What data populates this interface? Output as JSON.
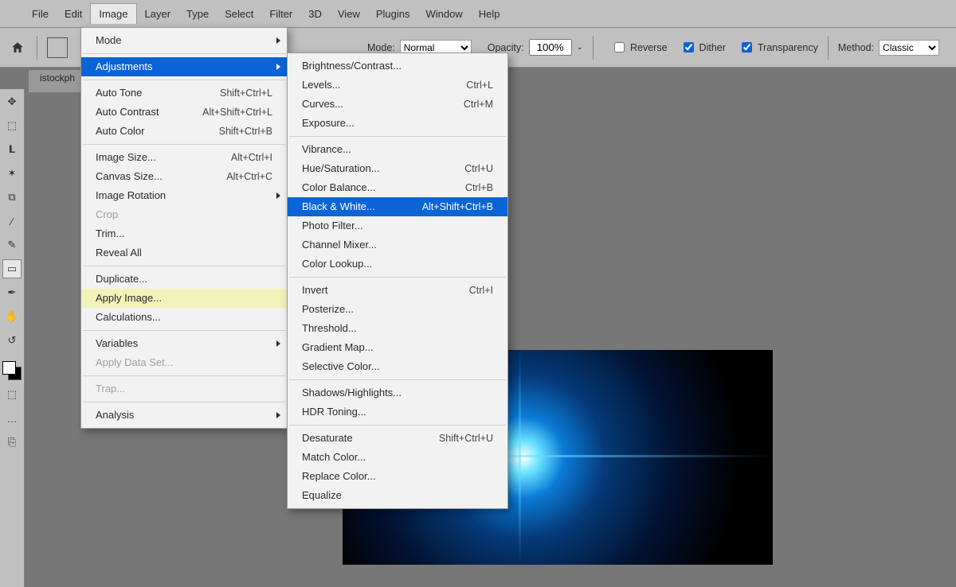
{
  "menubar": {
    "items": [
      "File",
      "Edit",
      "Image",
      "Layer",
      "Type",
      "Select",
      "Filter",
      "3D",
      "View",
      "Plugins",
      "Window",
      "Help"
    ],
    "open_index": 2
  },
  "optionsbar": {
    "mode_label": "Mode:",
    "mode_value": "Normal",
    "opacity_label": "Opacity:",
    "opacity_value": "100%",
    "reverse_label": "Reverse",
    "reverse_checked": false,
    "dither_label": "Dither",
    "dither_checked": true,
    "transparency_label": "Transparency",
    "transparency_checked": true,
    "method_label": "Method:",
    "method_value": "Classic"
  },
  "document_tab": "istockph",
  "image_menu": {
    "groups": [
      [
        {
          "label": "Mode",
          "submenu": true
        }
      ],
      [
        {
          "label": "Adjustments",
          "submenu": true,
          "selected": "blue"
        }
      ],
      [
        {
          "label": "Auto Tone",
          "shortcut": "Shift+Ctrl+L"
        },
        {
          "label": "Auto Contrast",
          "shortcut": "Alt+Shift+Ctrl+L"
        },
        {
          "label": "Auto Color",
          "shortcut": "Shift+Ctrl+B"
        }
      ],
      [
        {
          "label": "Image Size...",
          "shortcut": "Alt+Ctrl+I"
        },
        {
          "label": "Canvas Size...",
          "shortcut": "Alt+Ctrl+C"
        },
        {
          "label": "Image Rotation",
          "submenu": true
        },
        {
          "label": "Crop",
          "disabled": true
        },
        {
          "label": "Trim..."
        },
        {
          "label": "Reveal All"
        }
      ],
      [
        {
          "label": "Duplicate..."
        },
        {
          "label": "Apply Image...",
          "selected": "yellow"
        },
        {
          "label": "Calculations..."
        }
      ],
      [
        {
          "label": "Variables",
          "submenu": true
        },
        {
          "label": "Apply Data Set...",
          "disabled": true
        }
      ],
      [
        {
          "label": "Trap...",
          "disabled": true
        }
      ],
      [
        {
          "label": "Analysis",
          "submenu": true
        }
      ]
    ]
  },
  "adjustments_submenu": {
    "groups": [
      [
        {
          "label": "Brightness/Contrast..."
        },
        {
          "label": "Levels...",
          "shortcut": "Ctrl+L"
        },
        {
          "label": "Curves...",
          "shortcut": "Ctrl+M"
        },
        {
          "label": "Exposure..."
        }
      ],
      [
        {
          "label": "Vibrance..."
        },
        {
          "label": "Hue/Saturation...",
          "shortcut": "Ctrl+U"
        },
        {
          "label": "Color Balance...",
          "shortcut": "Ctrl+B"
        },
        {
          "label": "Black & White...",
          "shortcut": "Alt+Shift+Ctrl+B",
          "selected": "blue"
        },
        {
          "label": "Photo Filter..."
        },
        {
          "label": "Channel Mixer..."
        },
        {
          "label": "Color Lookup..."
        }
      ],
      [
        {
          "label": "Invert",
          "shortcut": "Ctrl+I"
        },
        {
          "label": "Posterize..."
        },
        {
          "label": "Threshold..."
        },
        {
          "label": "Gradient Map..."
        },
        {
          "label": "Selective Color..."
        }
      ],
      [
        {
          "label": "Shadows/Highlights..."
        },
        {
          "label": "HDR Toning..."
        }
      ],
      [
        {
          "label": "Desaturate",
          "shortcut": "Shift+Ctrl+U"
        },
        {
          "label": "Match Color..."
        },
        {
          "label": "Replace Color..."
        },
        {
          "label": "Equalize"
        }
      ]
    ]
  },
  "tools": [
    {
      "name": "move-tool",
      "glyph": "✥"
    },
    {
      "name": "marquee-tool",
      "glyph": "⬚"
    },
    {
      "name": "lasso-tool",
      "glyph": "𝗟"
    },
    {
      "name": "wand-tool",
      "glyph": "✶"
    },
    {
      "name": "crop-tool",
      "glyph": "⧉"
    },
    {
      "name": "eyedropper-tool",
      "glyph": "⁄"
    },
    {
      "name": "brush-tool",
      "glyph": "✎"
    },
    {
      "name": "gradient-tool",
      "glyph": "▭",
      "selected": true
    },
    {
      "name": "pen-tool",
      "glyph": "✒"
    },
    {
      "name": "hand-tool",
      "glyph": "✋"
    },
    {
      "name": "rotate-tool",
      "glyph": "↺"
    }
  ]
}
